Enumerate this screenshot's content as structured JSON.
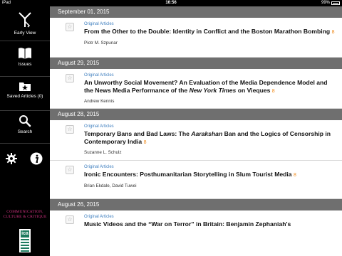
{
  "status": {
    "carrier": "iPad",
    "time": "16:56",
    "battery": "99%"
  },
  "sidebar": {
    "items": [
      {
        "label": "Early View"
      },
      {
        "label": "Issues"
      },
      {
        "label": "Saved Articles (0)"
      },
      {
        "label": "Search"
      }
    ],
    "brand_line1": "COMMUNICATION,",
    "brand_line2": "CULTURE & CRITIQUE",
    "logo_text": "ica"
  },
  "open_access_glyph": "8",
  "groups": [
    {
      "date": "September 01, 2015",
      "articles": [
        {
          "section": "Original Articles",
          "title": "From the Other to the Double: Identity in Conflict and the Boston Marathon Bombing",
          "author": "Piotr M. Szpunar"
        }
      ]
    },
    {
      "date": "August 29, 2015",
      "articles": [
        {
          "section": "Original Articles",
          "title_a": "An Unworthy Social Movement? An Evaluation of the Media Dependence Model and the News Media Performance of the ",
          "title_italic": "New York Times",
          "title_b": " on Vieques",
          "author": "Andrew Kennis"
        }
      ]
    },
    {
      "date": "August 28, 2015",
      "articles": [
        {
          "section": "Original Articles",
          "title_a": "Temporary Bans and Bad Laws: The ",
          "title_italic": "Aarakshan",
          "title_b": " Ban and the Logics of Censorship in Contemporary India",
          "author": "Suzanne L. Schulz"
        },
        {
          "section": "Original Articles",
          "title": "Ironic Encounters: Posthumanitarian Storytelling in Slum Tourist Media",
          "author": "Brian Ekdale, David Tuwei"
        }
      ]
    },
    {
      "date": "August 26, 2015",
      "articles": [
        {
          "section": "Original Articles",
          "title": "Music Videos and the “War on Terror” in Britain: Benjamin Zephaniah's",
          "author": ""
        }
      ]
    }
  ]
}
